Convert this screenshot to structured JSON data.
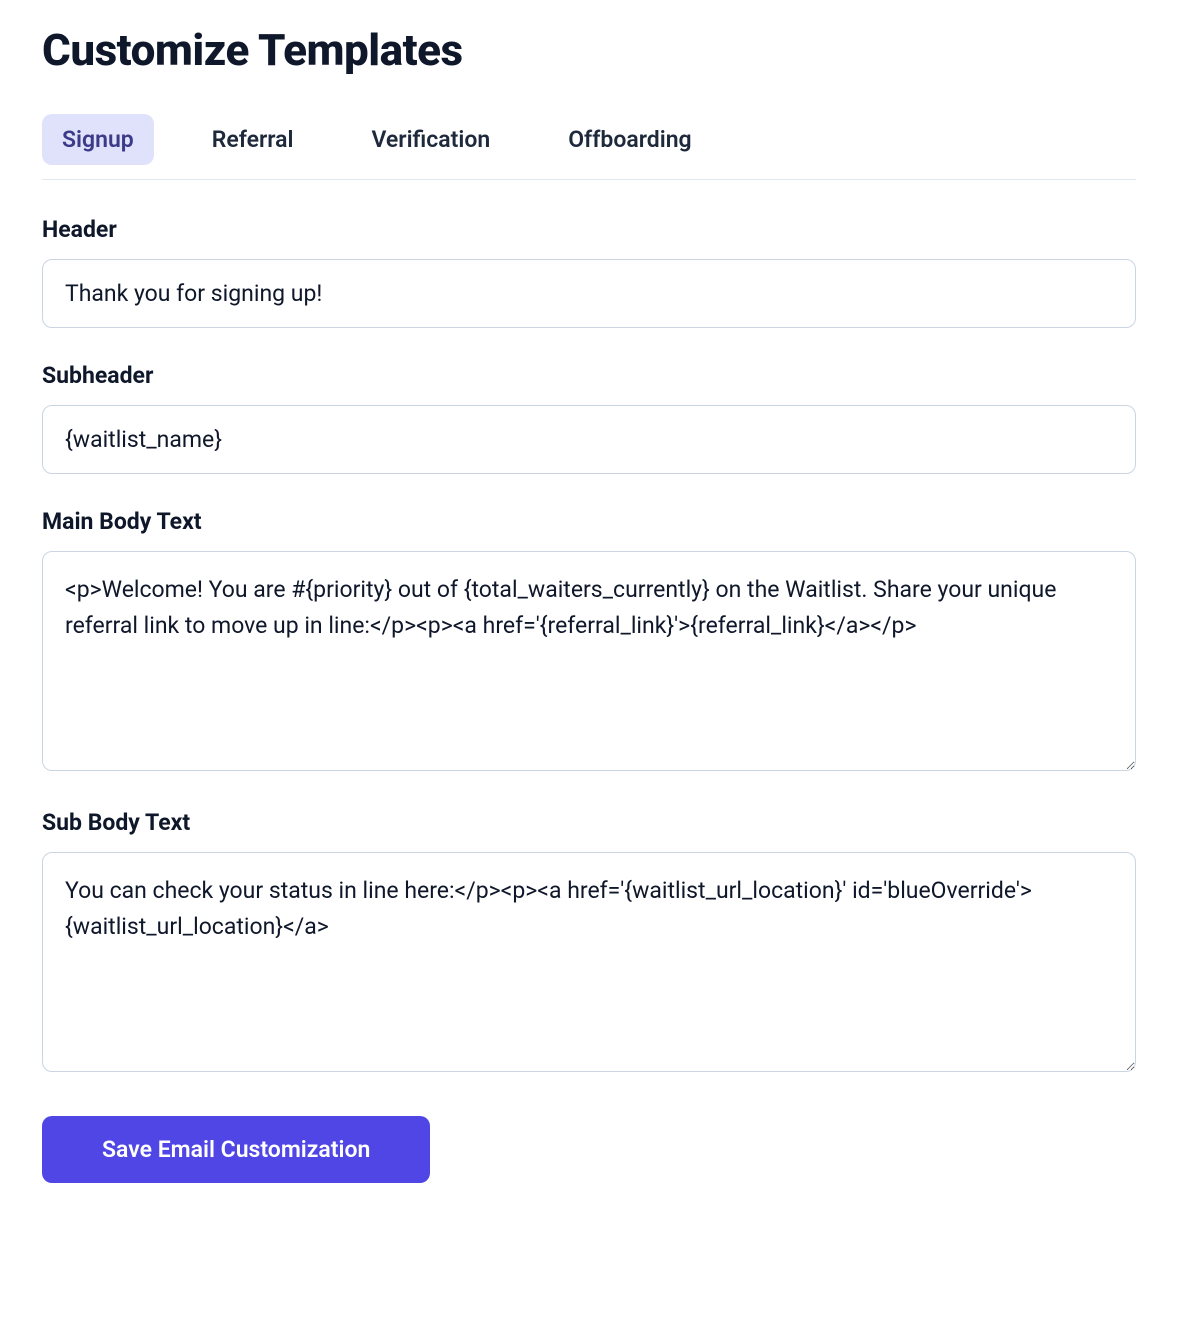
{
  "title": "Customize Templates",
  "tabs": [
    {
      "id": "signup",
      "label": "Signup",
      "active": true
    },
    {
      "id": "referral",
      "label": "Referral",
      "active": false
    },
    {
      "id": "verification",
      "label": "Verification",
      "active": false
    },
    {
      "id": "offboarding",
      "label": "Offboarding",
      "active": false
    }
  ],
  "fields": {
    "header": {
      "label": "Header",
      "value": "Thank you for signing up!"
    },
    "subheader": {
      "label": "Subheader",
      "value": "{waitlist_name}"
    },
    "main_body": {
      "label": "Main Body Text",
      "value": "<p>Welcome! You are #{priority} out of {total_waiters_currently} on the Waitlist. Share your unique referral link to move up in line:</p><p><a href='{referral_link}'>{referral_link}</a></p>"
    },
    "sub_body": {
      "label": "Sub Body Text",
      "value": "You can check your status in line here:</p><p><a href='{waitlist_url_location}' id='blueOverride'>{waitlist_url_location}</a>"
    }
  },
  "actions": {
    "save_label": "Save Email Customization"
  },
  "colors": {
    "primary": "#4f46e5",
    "tab_active_bg": "#e0e2fb",
    "text": "#0f172a",
    "border": "#cbd5e1"
  }
}
